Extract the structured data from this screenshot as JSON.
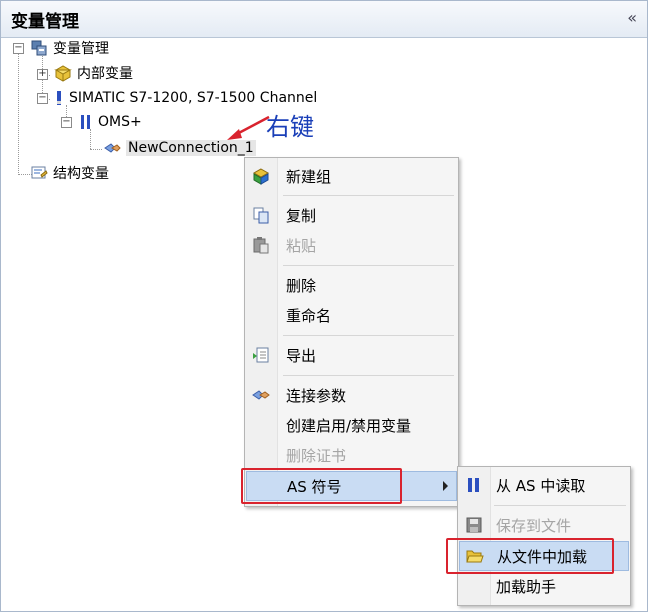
{
  "panel": {
    "title": "变量管理",
    "collapse_glyph": "«"
  },
  "tree": {
    "root": "变量管理",
    "internal": "内部变量",
    "channel": "SIMATIC S7-1200, S7-1500 Channel",
    "oms": "OMS+",
    "connection": "NewConnection_1",
    "structure": "结构变量",
    "expander_minus": "−",
    "expander_plus": "+"
  },
  "annotation": "右键",
  "context_menu": {
    "items": [
      {
        "label": "新建组",
        "icon": "new-group-icon",
        "disabled": false
      },
      {
        "label": "复制",
        "icon": "copy-icon",
        "disabled": false
      },
      {
        "label": "粘贴",
        "icon": "paste-icon",
        "disabled": true
      },
      {
        "label": "删除",
        "icon": "",
        "disabled": false
      },
      {
        "label": "重命名",
        "icon": "",
        "disabled": false
      },
      {
        "label": "导出",
        "icon": "export-icon",
        "disabled": false
      },
      {
        "label": "连接参数",
        "icon": "connection-params-icon",
        "disabled": false
      },
      {
        "label": "创建启用/禁用变量",
        "icon": "",
        "disabled": false
      },
      {
        "label": "删除证书",
        "icon": "",
        "disabled": true
      },
      {
        "label": "AS 符号",
        "icon": "",
        "disabled": false,
        "submenu": true
      }
    ]
  },
  "submenu": {
    "items": [
      {
        "label": "从 AS 中读取",
        "icon": "read-from-as-icon",
        "disabled": false
      },
      {
        "label": "保存到文件",
        "icon": "save-icon",
        "disabled": true
      },
      {
        "label": "从文件中加载",
        "icon": "open-folder-icon",
        "disabled": false,
        "highlighted": true
      },
      {
        "label": "加载助手",
        "icon": "",
        "disabled": false
      }
    ]
  },
  "colors": {
    "highlight": "#c9dcf3",
    "red_box": "#d9232e",
    "annotation": "#1a3fb8"
  }
}
